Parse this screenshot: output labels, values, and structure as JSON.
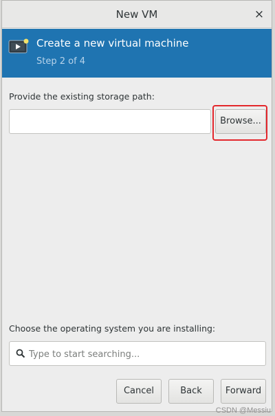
{
  "window": {
    "title": "New VM",
    "close_glyph": "×"
  },
  "banner": {
    "icon": "vm-monitor-icon",
    "title": "Create a new virtual machine",
    "step": "Step 2 of 4",
    "colors": {
      "background": "#1f74b1",
      "title": "#ffffff",
      "step": "#b7d3ea"
    }
  },
  "storage": {
    "label": "Provide the existing storage path:",
    "value": "",
    "browse_label": "Browse..."
  },
  "os": {
    "label": "Choose the operating system you are installing:",
    "search_placeholder": "Type to start searching..."
  },
  "buttons": {
    "cancel": "Cancel",
    "back": "Back",
    "forward": "Forward"
  },
  "watermark": "CSDN @Messiu",
  "highlight_color": "#e3262b"
}
